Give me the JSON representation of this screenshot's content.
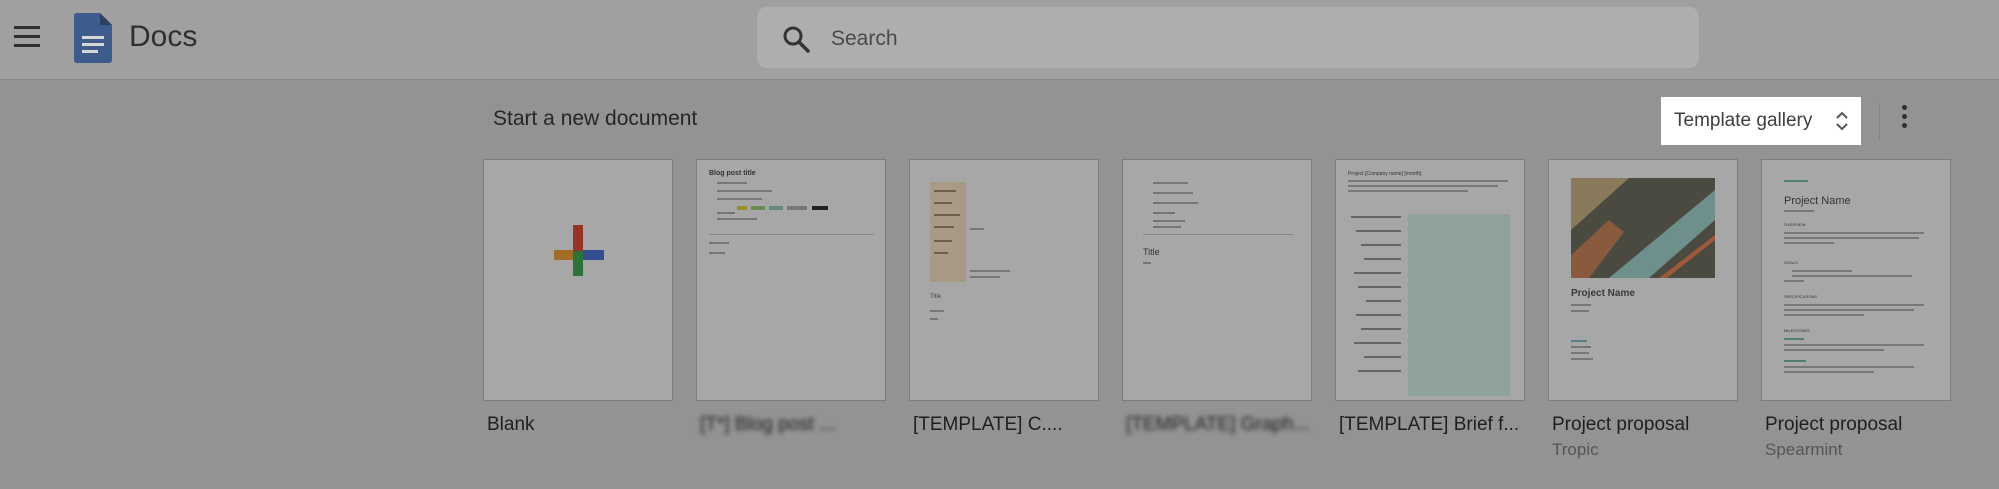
{
  "app": {
    "title": "Docs"
  },
  "search": {
    "placeholder": "Search"
  },
  "section": {
    "title": "Start a new document"
  },
  "toolbar": {
    "gallery_label": "Template gallery"
  },
  "templates": [
    {
      "label": "Blank",
      "sub": ""
    },
    {
      "label": "[T*] Blog post ...",
      "sub": ""
    },
    {
      "label": "[TEMPLATE] C....",
      "sub": ""
    },
    {
      "label": "[TEMPLATE] Graph...",
      "sub": ""
    },
    {
      "label": "[TEMPLATE] Brief f...",
      "sub": ""
    },
    {
      "label": "Project proposal",
      "sub": "Tropic"
    },
    {
      "label": "Project proposal",
      "sub": "Spearmint"
    }
  ],
  "thumbnails": {
    "blog": {
      "heading": "Blog post title",
      "lines": [
        "Gold",
        "Holiday",
        "Leadership"
      ]
    },
    "generic": {
      "heading": "Title"
    },
    "brief": {
      "heading": "Project [Company name] [month]"
    },
    "tropic": {
      "heading": "Project Name"
    },
    "spearmint": {
      "heading": "Project Name",
      "sections": [
        "OVERVIEW",
        "GOALS",
        "SPECIFICATIONS",
        "MILESTONES"
      ]
    }
  },
  "icons": [
    "menu-icon",
    "docs-logo-icon",
    "search-icon",
    "updown-icon",
    "more-vert-icon",
    "plus-icon"
  ],
  "colors": {
    "blue": "#4285f4",
    "red": "#ea4335",
    "yellow": "#fbbc04",
    "green": "#34a853",
    "topbar": "#a0a0a0",
    "overlay": "#939393"
  }
}
